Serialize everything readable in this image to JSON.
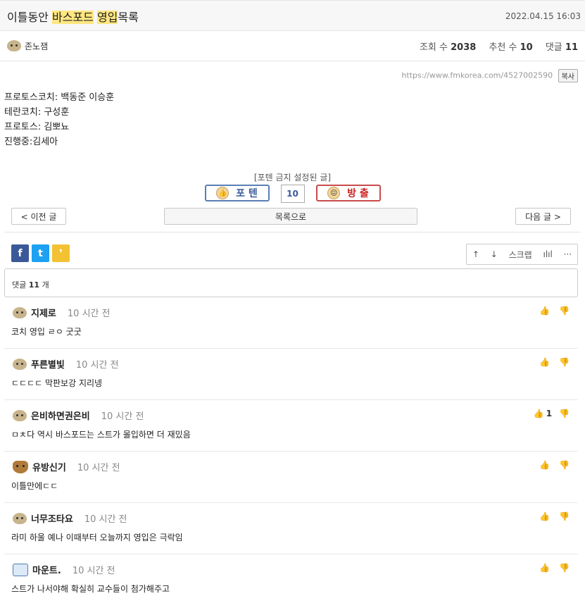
{
  "post": {
    "title_parts": [
      "이틀동안 ",
      "바스포드",
      " ",
      "영입",
      "목록"
    ],
    "date": "2022.04.15 16:03",
    "author": "존노잼",
    "views_label": "조회 수",
    "views": "2038",
    "likes_label": "추천 수",
    "likes": "10",
    "comments_label": "댓글",
    "comments": "11",
    "url": "https://www.fmkorea.com/4527002590",
    "copy_label": "복사",
    "body_lines": [
      "프로토스코치: 백동준 이승훈",
      "테란코치: 구성훈",
      "프로토스: 김뽀뇨",
      "진행중:김세아"
    ]
  },
  "vote": {
    "note": "[포텐 금지 설정된 글]",
    "up_label": "포 텐",
    "count": "10",
    "down_label": "방 출"
  },
  "nav": {
    "prev": "< 이전 글",
    "list": "목록으로",
    "next": "다음 글 >"
  },
  "tools": {
    "up": "↑",
    "down": "↓",
    "scrap": "스크랩",
    "stats": "ılıl",
    "more": "···"
  },
  "share": {
    "facebook": "f",
    "twitter": "t",
    "kakao": "❜"
  },
  "comment_box": {
    "label": "댓글",
    "count": "11",
    "suffix": "개"
  },
  "comments": [
    {
      "name": "지제로",
      "time": "10 시간 전",
      "text": "코치 영입 ㄹㅇ 굿굿",
      "likes": "",
      "avatar": "face"
    },
    {
      "name": "푸른별빛",
      "time": "10 시간 전",
      "text": "ㄷㄷㄷㄷ 막판보강 지리넹",
      "likes": "",
      "avatar": "face"
    },
    {
      "name": "은비하면권은비",
      "time": "10 시간 전",
      "text": "ㅁㅊ다 역시 바스포드는 스트가 몰입하면 더 재밌음",
      "likes": "1",
      "avatar": "face"
    },
    {
      "name": "유방신기",
      "time": "10 시간 전",
      "text": "이틀만에ㄷㄷ",
      "likes": "",
      "avatar": "dog"
    },
    {
      "name": "너무조타요",
      "time": "10 시간 전",
      "text": "라미 하울 예나 이때부터 오늘까지 영입은 극락임",
      "likes": "",
      "avatar": "face"
    },
    {
      "name": "마운트.",
      "time": "10 시간 전",
      "text": "스트가 나서야해 확실히 교수들이 첨가해주고",
      "likes": "",
      "avatar": "ghost"
    }
  ],
  "colors": {
    "highlight": "#ffe680",
    "facebook": "#3b5998",
    "twitter": "#1da1f2",
    "kakao": "#f2c233",
    "upvote": "#3a5a9a",
    "downvote": "#cc2222"
  }
}
